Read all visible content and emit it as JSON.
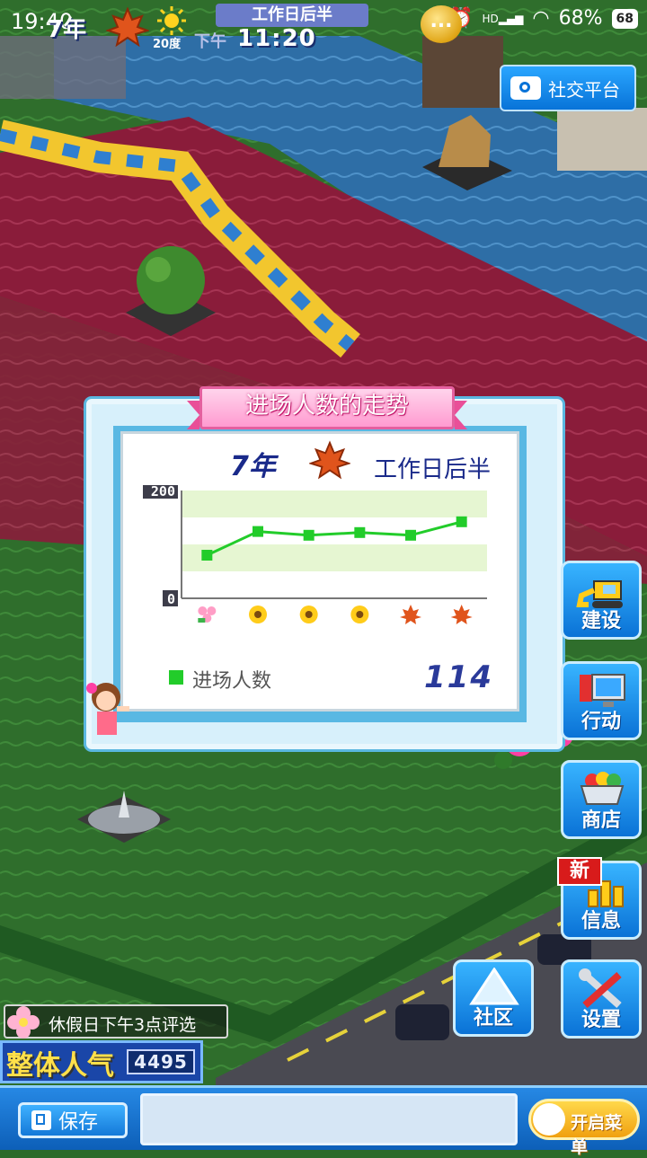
{
  "status_bar": {
    "time": "19:40",
    "hd": "HD",
    "battery_percent": "68%",
    "battery_icon": "68"
  },
  "hud": {
    "year": "7年",
    "season_icon": "maple-leaf-icon",
    "weather_icon": "sun-icon",
    "temperature": "20度",
    "period": "工作日后半",
    "ampm": "下午",
    "clock": "11:20",
    "coin_text": "..."
  },
  "social": {
    "label": "社交平台"
  },
  "dialog": {
    "title": "进场人数的走势",
    "year": "7年",
    "period": "工作日后半",
    "legend_label": "进场人数",
    "total": "114"
  },
  "chart_data": {
    "type": "line",
    "title": "进场人数的走势",
    "ylim": [
      0,
      200
    ],
    "y_ticks": [
      "200",
      "0"
    ],
    "categories": [
      "flower-icon",
      "sunflower-icon",
      "sunflower-icon",
      "sunflower-icon",
      "maple-leaf-icon",
      "maple-leaf-icon"
    ],
    "series": [
      {
        "name": "进场人数",
        "color": "#22cc2a",
        "values": [
          80,
          124,
          117,
          122,
          117,
          142
        ]
      }
    ],
    "grid": true
  },
  "side_menu": {
    "build": "建设",
    "action": "行动",
    "shop": "商店",
    "info": "信息",
    "info_badge": "新",
    "community": "社区",
    "settings": "设置"
  },
  "bottom": {
    "eval_text": "休假日下午3点评选",
    "popularity_label": "整体人气",
    "popularity_value": "4495",
    "save_label": "保存",
    "menu_label": "开启菜单"
  },
  "colors": {
    "water": "#2a6fa8",
    "carpet": "#8e1f3c",
    "grass": "#2b6b2a",
    "accent": "#0a72d6"
  }
}
